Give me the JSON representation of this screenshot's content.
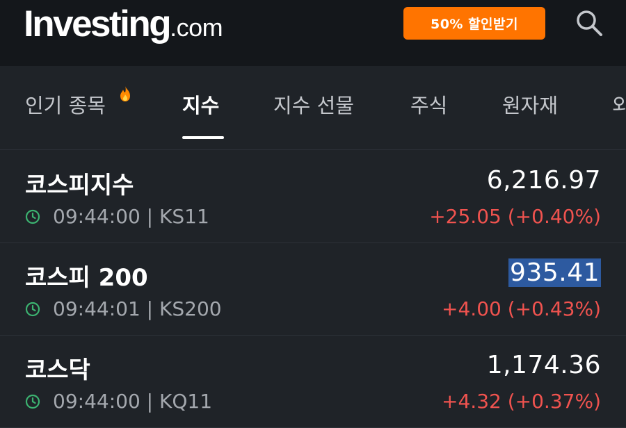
{
  "header": {
    "logo_main": "Investing",
    "logo_suffix": ".com",
    "promo_label": "50% 할인받기"
  },
  "tabs": [
    {
      "label": "인기 종목",
      "active": false
    },
    {
      "label": "지수",
      "active": true
    },
    {
      "label": "지수 선물",
      "active": false
    },
    {
      "label": "주식",
      "active": false
    },
    {
      "label": "원자재",
      "active": false
    },
    {
      "label": "외",
      "active": false
    }
  ],
  "rows": [
    {
      "name": "코스피지수",
      "time": "09:44:00",
      "code": "KS11",
      "meta": "09:44:00 | KS11",
      "price": "6,216.97",
      "change": "+25.05 (+0.40%)"
    },
    {
      "name": "코스피 200",
      "time": "09:44:01",
      "code": "KS200",
      "meta": "09:44:01 | KS200",
      "price": "935.41",
      "change": "+4.00 (+0.43%)"
    },
    {
      "name": "코스닥",
      "time": "09:44:00",
      "code": "KQ11",
      "meta": "09:44:00 | KQ11",
      "price": "1,174.36",
      "change": "+4.32 (+0.37%)"
    }
  ],
  "colors": {
    "accent_orange": "#ff7400",
    "positive_change": "#f0534f",
    "clock_green": "#3cb371",
    "selection_highlight": "#2d5aa0"
  },
  "icons": {
    "search": "search-icon",
    "clock": "clock-icon",
    "fire": "fire-icon"
  }
}
